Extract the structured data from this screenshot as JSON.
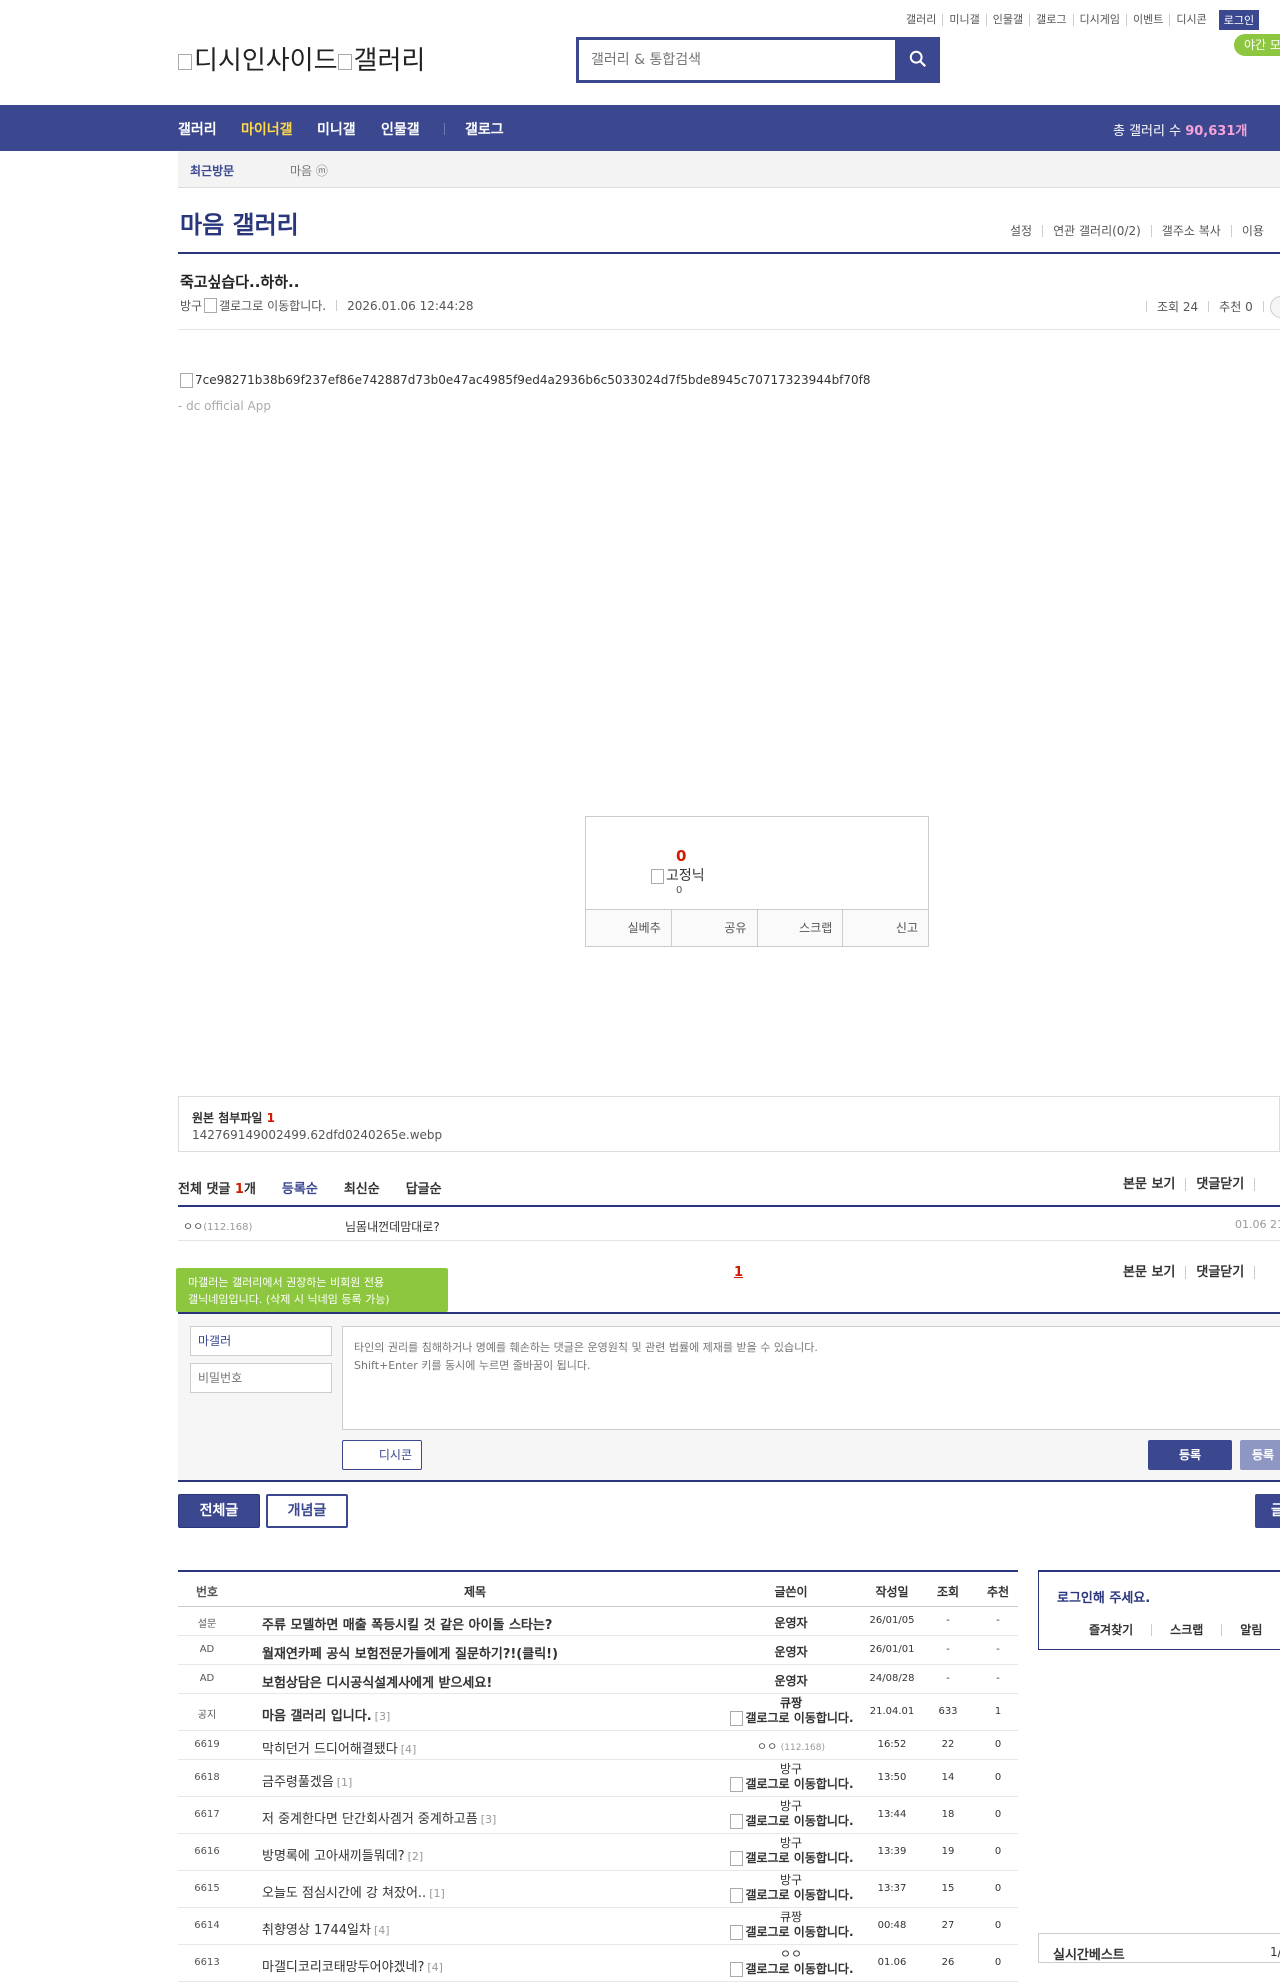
{
  "topnav": {
    "items": [
      "갤러리",
      "미니갤",
      "인물갤",
      "갤로그",
      "디시게임",
      "이벤트",
      "디시콘"
    ],
    "login": "로그인",
    "night_mode": "야간 모"
  },
  "logo": {
    "text1": "디시인사이드",
    "text2": "갤러리"
  },
  "search": {
    "placeholder": "갤러리 & 통합검색"
  },
  "mainnav": {
    "items": [
      "갤러리",
      "마이너갤",
      "미니갤",
      "인물갤",
      "갤로그"
    ],
    "total_label": "총 갤러리 수 ",
    "total_value": "90,631개"
  },
  "subnav": {
    "recent_label": "최근방문",
    "recent_item": "마음 ⓜ"
  },
  "gallery": {
    "title": "마음 갤러리",
    "links": [
      "설정",
      "연관 갤러리(0/2)",
      "갤주소 복사",
      "이용"
    ]
  },
  "post": {
    "title": "죽고싶습다..하하..",
    "writer": "방구",
    "writer_icon_alt": "갤로그로 이동합니다.",
    "date": "2026.01.06 12:44:28",
    "views_label": "조회 24",
    "recommend_label": "추천 0",
    "image_alt": "7ce98271b38b69f237ef86e742887d73b0e47ac4985f9ed4a2936b6c5033024d7f5bde8945c70717323944bf70f8",
    "signature": "- dc official App"
  },
  "recommend": {
    "count": "0",
    "fixed_label": "고정닉",
    "fixed_count": "0",
    "buttons": [
      "실베추",
      "공유",
      "스크랩",
      "신고"
    ]
  },
  "attachment": {
    "label": "원본 첨부파일 ",
    "count": "1",
    "filename": "142769149002499.62dfd0240265e.webp"
  },
  "comments": {
    "total_label": "전체 댓글 ",
    "total_count": "1",
    "total_unit": "개",
    "sorts": [
      "등록순",
      "최신순",
      "답글순"
    ],
    "tools": [
      "본문 보기",
      "댓글닫기"
    ],
    "items": [
      {
        "nick": "ㅇㅇ",
        "ip": "(112.168)",
        "text": "님몸내껀데맘대로?",
        "time": "01.06 21"
      }
    ],
    "page": "1"
  },
  "write": {
    "tooltip_line1": "마갤러는 갤러리에서 권장하는 비회원 전용",
    "tooltip_line2": "갤닉네임입니다. (삭제 시 닉네임 등록 가능)",
    "nick_value": "마갤러",
    "password_placeholder": "비밀번호",
    "textarea_placeholder": "타인의 권리를 침해하거나 명예를 훼손하는 댓글은 운영원칙 및 관련 법률에 제재를 받을 수 있습니다.\nShift+Enter 키를 동시에 누르면 줄바꿈이 됩니다.",
    "dccon_label": "디시콘",
    "submit_label": "등록",
    "submit2_label": "등록"
  },
  "tabs": {
    "all": "전체글",
    "concept": "개념글",
    "write": "글"
  },
  "list": {
    "headers": [
      "번호",
      "제목",
      "글쓴이",
      "작성일",
      "조회",
      "추천"
    ],
    "rows": [
      {
        "num": "설문",
        "title": "주류 모델하면 매출 폭등시킬 것 같은 아이돌 스타는?",
        "replies": "",
        "writer": "운영자",
        "writer_type": "bold",
        "date": "26/01/05",
        "views": "-",
        "rec": "-"
      },
      {
        "num": "AD",
        "title": "월재연카페 공식 보험전문가들에게 질문하기?!(클릭!)",
        "replies": "",
        "writer": "운영자",
        "writer_type": "bold",
        "date": "26/01/01",
        "views": "-",
        "rec": "-"
      },
      {
        "num": "AD",
        "title": "보험상담은 디시공식설계사에게 받으세요!",
        "replies": "",
        "writer": "운영자",
        "writer_type": "bold",
        "date": "24/08/28",
        "views": "-",
        "rec": "-"
      },
      {
        "num": "공지",
        "title": "마음 갤러리 입니다.",
        "replies": "[3]",
        "writer": "큐짱",
        "writer_type": "boldgallog",
        "date": "21.04.01",
        "views": "633",
        "rec": "1"
      },
      {
        "num": "6619",
        "title": "막히던거 드디어해결됐다",
        "replies": "[4]",
        "writer": "ㅇㅇ",
        "ip": "(112.168)",
        "writer_type": "ip",
        "date": "16:52",
        "views": "22",
        "rec": "0"
      },
      {
        "num": "6618",
        "title": "금주령풀겠음",
        "replies": "[1]",
        "writer": "방구",
        "writer_type": "gallog",
        "date": "13:50",
        "views": "14",
        "rec": "0"
      },
      {
        "num": "6617",
        "title": "저 중계한다면 단간회사겜거 중계하고픔",
        "replies": "[3]",
        "writer": "방구",
        "writer_type": "gallog",
        "date": "13:44",
        "views": "18",
        "rec": "0"
      },
      {
        "num": "6616",
        "title": "방명록에 고아새끼들뭐데?",
        "replies": "[2]",
        "writer": "방구",
        "writer_type": "gallog",
        "date": "13:39",
        "views": "19",
        "rec": "0"
      },
      {
        "num": "6615",
        "title": "오늘도 점심시간에 강 쳐잤어..",
        "replies": "[1]",
        "writer": "방구",
        "writer_type": "gallog",
        "date": "13:37",
        "views": "15",
        "rec": "0"
      },
      {
        "num": "6614",
        "title": "취향영상 1744일차",
        "replies": "[4]",
        "writer": "큐짱",
        "writer_type": "gallog",
        "date": "00:48",
        "views": "27",
        "rec": "0"
      },
      {
        "num": "6613",
        "title": "마갤디코리코태망두어야겠네?",
        "replies": "[4]",
        "writer": "ㅇㅇ",
        "writer_type": "gallog",
        "date": "01.06",
        "views": "26",
        "rec": "0"
      }
    ],
    "gallog_alt": "갤로그로 이동합니다."
  },
  "side": {
    "login_msg": "로그인해 주세요.",
    "login_links": [
      "즐겨찾기",
      "스크랩",
      "알림"
    ],
    "hot_title": "실시간베스트",
    "hot_page": "1/"
  },
  "colors": {
    "brand": "#3b4890",
    "accent": "#29367c",
    "highlight": "#ffd949",
    "notice": "#d31900",
    "green": "#8dc63f"
  }
}
